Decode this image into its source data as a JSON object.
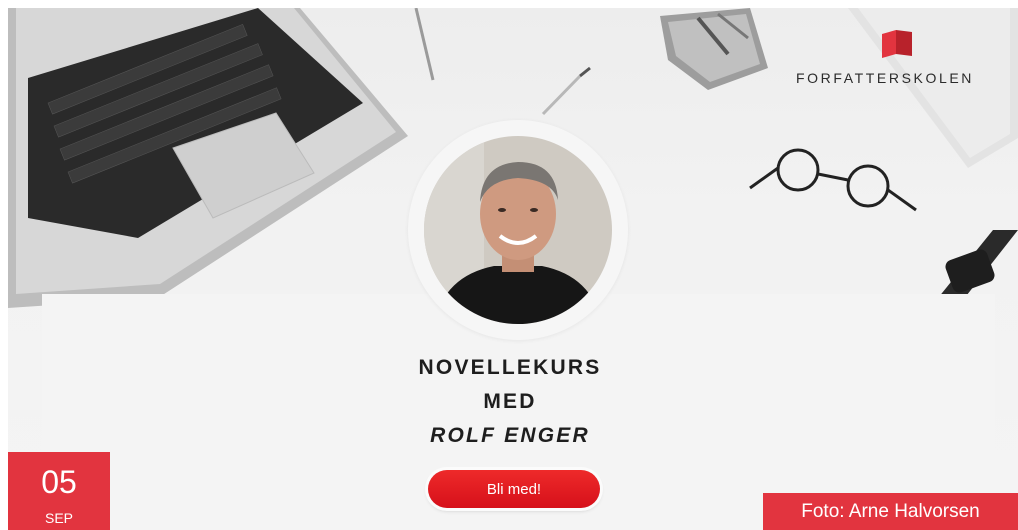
{
  "brand": {
    "name": "FORFATTERSKOLEN",
    "logo_icon": "book-logo-icon",
    "logo_color": "#e2343f"
  },
  "course": {
    "line1": "NOVELLEKURS",
    "line2": "MED",
    "instructor": "ROLF ENGER"
  },
  "cta": {
    "label": "Bli med!",
    "color": "#e0141f"
  },
  "date": {
    "day": "05",
    "month": "SEP",
    "color": "#e2343f"
  },
  "photo_credit": "Foto: Arne Halvorsen",
  "decor_icons": [
    "laptop-icon",
    "pen-icon",
    "pencil-cup-icon",
    "glasses-icon",
    "smartwatch-icon",
    "avatar-photo"
  ]
}
